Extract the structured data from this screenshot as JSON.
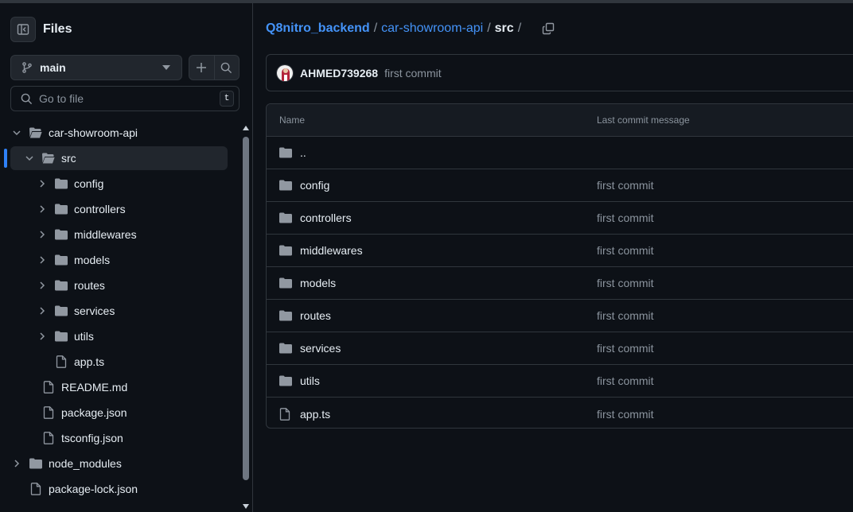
{
  "sidebar": {
    "title": "Files",
    "branch": "main",
    "goto_placeholder": "Go to file",
    "goto_shortcut": "t",
    "tree": [
      {
        "label": "car-showroom-api",
        "kind": "folder-open",
        "depth": 0,
        "expanded": true
      },
      {
        "label": "src",
        "kind": "folder-open",
        "depth": 1,
        "expanded": true,
        "active": true
      },
      {
        "label": "config",
        "kind": "folder",
        "depth": 2
      },
      {
        "label": "controllers",
        "kind": "folder",
        "depth": 2
      },
      {
        "label": "middlewares",
        "kind": "folder",
        "depth": 2
      },
      {
        "label": "models",
        "kind": "folder",
        "depth": 2
      },
      {
        "label": "routes",
        "kind": "folder",
        "depth": 2
      },
      {
        "label": "services",
        "kind": "folder",
        "depth": 2
      },
      {
        "label": "utils",
        "kind": "folder",
        "depth": 2
      },
      {
        "label": "app.ts",
        "kind": "file",
        "depth": 2
      },
      {
        "label": "README.md",
        "kind": "file",
        "depth": 1
      },
      {
        "label": "package.json",
        "kind": "file",
        "depth": 1
      },
      {
        "label": "tsconfig.json",
        "kind": "file",
        "depth": 1
      },
      {
        "label": "node_modules",
        "kind": "folder",
        "depth": 0
      },
      {
        "label": "package-lock.json",
        "kind": "file",
        "depth": 0
      }
    ]
  },
  "breadcrumb": {
    "repo": "Q8nitro_backend",
    "dir": "car-showroom-api",
    "current": "src",
    "sep": "/"
  },
  "commit": {
    "author": "AHMED739268",
    "message": "first commit"
  },
  "table": {
    "col_name": "Name",
    "col_msg": "Last commit message",
    "parent": "..",
    "rows": [
      {
        "name": "config",
        "kind": "folder",
        "message": "first commit"
      },
      {
        "name": "controllers",
        "kind": "folder",
        "message": "first commit"
      },
      {
        "name": "middlewares",
        "kind": "folder",
        "message": "first commit"
      },
      {
        "name": "models",
        "kind": "folder",
        "message": "first commit"
      },
      {
        "name": "routes",
        "kind": "folder",
        "message": "first commit"
      },
      {
        "name": "services",
        "kind": "folder",
        "message": "first commit"
      },
      {
        "name": "utils",
        "kind": "folder",
        "message": "first commit"
      },
      {
        "name": "app.ts",
        "kind": "file",
        "message": "first commit"
      }
    ]
  },
  "colors": {
    "accent": "#4493f8",
    "muted": "#8b949e",
    "folder_icon": "#9198a1"
  }
}
